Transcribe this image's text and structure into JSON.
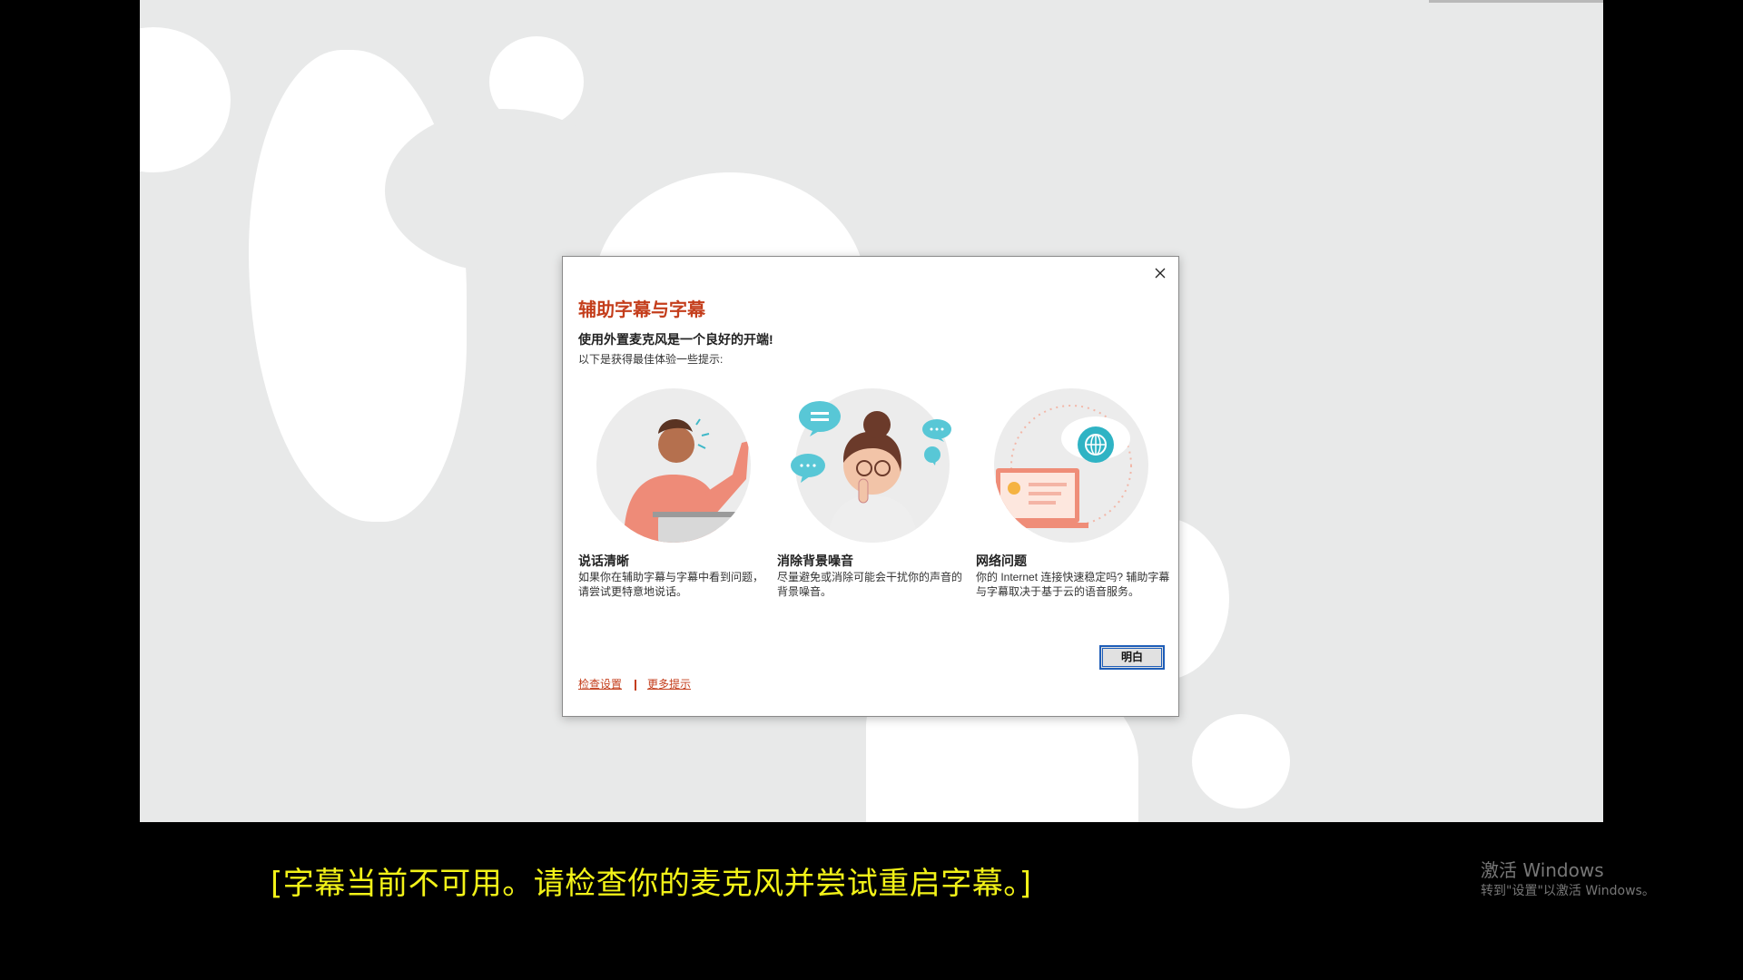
{
  "dialog": {
    "title": "辅助字幕与字幕",
    "subtitle": "使用外置麦克风是一个良好的开端!",
    "description": "以下是获得最佳体验一些提示:",
    "tips": [
      {
        "heading": "说话清晰",
        "text": "如果你在辅助字幕与字幕中看到问题，请尝试更特意地说话。",
        "illustration": "person-speaking-icon"
      },
      {
        "heading": "消除背景噪音",
        "text": "尽量避免或消除可能会干扰你的声音的背景噪音。",
        "illustration": "person-shushing-icon"
      },
      {
        "heading": "网络问题",
        "text": "你的 Internet 连接快速稳定吗? 辅助字幕与字幕取决于基于云的语音服务。",
        "illustration": "laptop-globe-icon"
      }
    ],
    "ok_label": "明白",
    "links": {
      "check_settings": "检查设置",
      "more_tips": "更多提示"
    },
    "close_icon": "close-icon"
  },
  "caption_text": "[字幕当前不可用。请检查你的麦克风并尝试重启字幕。]",
  "watermark": {
    "line1": "激活 Windows",
    "line2": "转到\"设置\"以激活 Windows。"
  },
  "colors": {
    "accent": "#c43e1c",
    "caption": "#f2f218",
    "slide_bg": "#e8e9e9"
  }
}
